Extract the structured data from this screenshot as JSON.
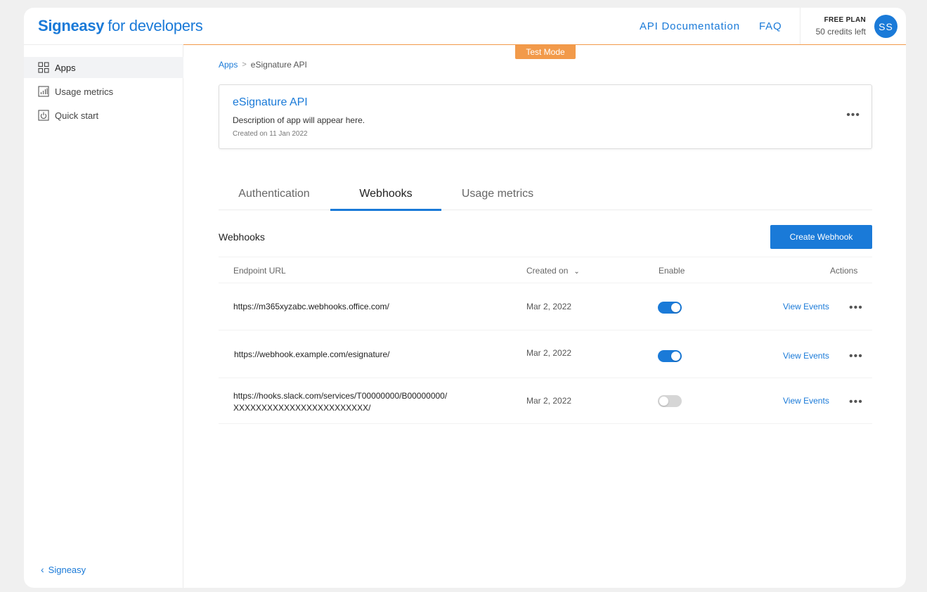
{
  "header": {
    "brand_main": "Signeasy",
    "brand_sub": "for developers",
    "links": [
      "API Documentation",
      "FAQ"
    ],
    "plan": "FREE PLAN",
    "credits": "50 credits left",
    "avatar": "SS"
  },
  "sidebar": {
    "items": [
      {
        "label": "Apps",
        "icon": "apps-grid-icon",
        "active": true
      },
      {
        "label": "Usage metrics",
        "icon": "bar-chart-icon",
        "active": false
      },
      {
        "label": "Quick start",
        "icon": "power-icon",
        "active": false
      }
    ],
    "back_label": "Signeasy"
  },
  "mode_badge": "Test Mode",
  "breadcrumb": {
    "root": "Apps",
    "current": "eSignature API"
  },
  "app": {
    "name": "eSignature API",
    "description": "Description of app will appear here.",
    "created": "Created on 11 Jan 2022"
  },
  "tabs": [
    {
      "label": "Authentication",
      "active": false
    },
    {
      "label": "Webhooks",
      "active": true
    },
    {
      "label": "Usage metrics",
      "active": false
    }
  ],
  "webhooks": {
    "title": "Webhooks",
    "create_label": "Create Webhook",
    "columns": {
      "url": "Endpoint URL",
      "created": "Created on",
      "enable": "Enable",
      "actions": "Actions"
    },
    "rows": [
      {
        "url_line1": "https://m365xyzabc.webhooks.office.com/",
        "url_line2": "",
        "created": "Mar 2, 2022",
        "enabled": true,
        "action": "View Events"
      },
      {
        "url_line1": "https://webhook.example.com/esignature/",
        "url_line2": "",
        "created": "Mar 2, 2022",
        "enabled": true,
        "action": "View Events"
      },
      {
        "url_line1": "https://hooks.slack.com/services/T00000000/B00000000/",
        "url_line2": "XXXXXXXXXXXXXXXXXXXXXXXX/",
        "created": "Mar 2, 2022",
        "enabled": false,
        "action": "View Events"
      }
    ]
  },
  "colors": {
    "accent": "#1a7ad8",
    "test_mode": "#f29a4a"
  }
}
